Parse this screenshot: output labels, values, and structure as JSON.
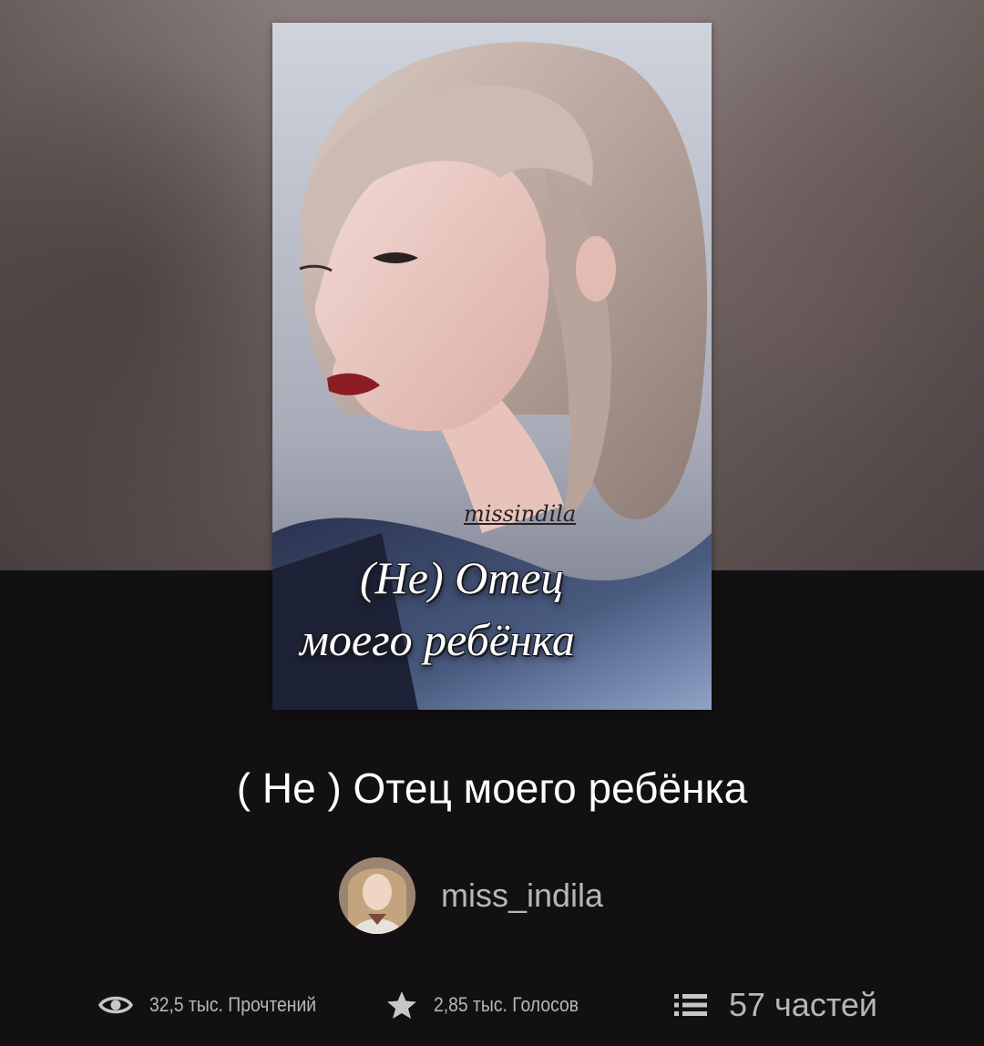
{
  "cover": {
    "signature": "missindila",
    "title_line1": "(Не) Отец",
    "title_line2": "моего ребёнка"
  },
  "story": {
    "title": "( Не ) Отец моего ребёнка",
    "author": "miss_indila"
  },
  "stats": {
    "reads": "32,5 тыс. Прочтений",
    "votes": "2,85 тыс. Голосов",
    "parts": "57 частей"
  },
  "icons": {
    "reads": "eye-icon",
    "votes": "star-icon",
    "parts": "list-icon"
  }
}
